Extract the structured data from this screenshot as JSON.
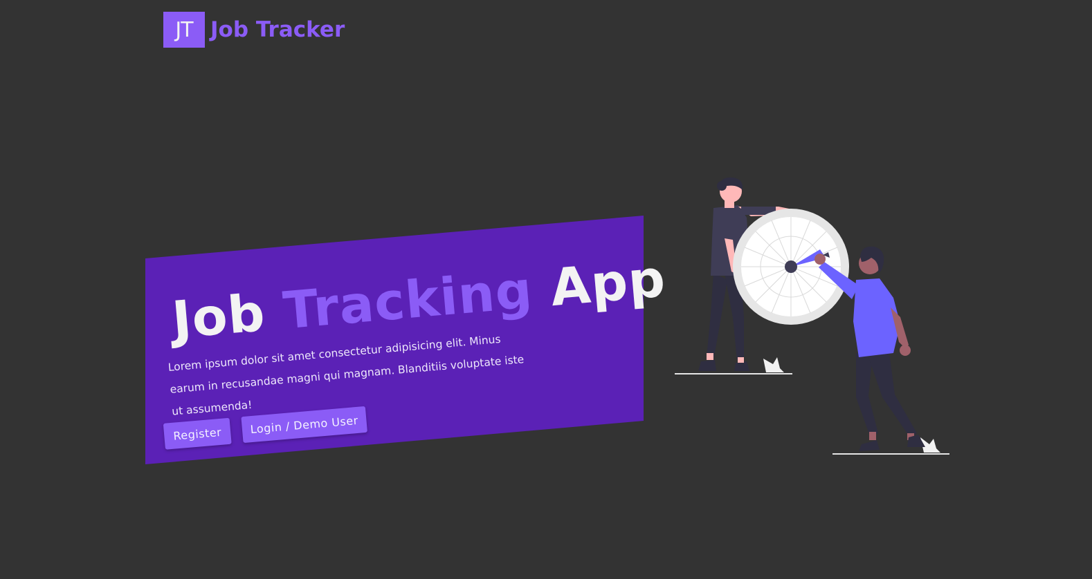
{
  "brand": {
    "logo_initials": "JT",
    "name": "Job Tracker"
  },
  "hero": {
    "title_part1": "Job",
    "title_part2": "Tracking",
    "title_part3": "App",
    "description": "Lorem ipsum dolor sit amet consectetur adipisicing elit. Minus earum in recusandae magni qui magnam. Blanditiis voluptate iste ut assumenda!",
    "register_label": "Register",
    "login_label": "Login / Demo User"
  },
  "illustration": {
    "icon": "people-with-spinning-wheel-illustration"
  },
  "colors": {
    "background": "#333333",
    "primary": "#8b5cf6",
    "hero_band": "#5b21b6",
    "text_light": "#f3f3f3"
  }
}
